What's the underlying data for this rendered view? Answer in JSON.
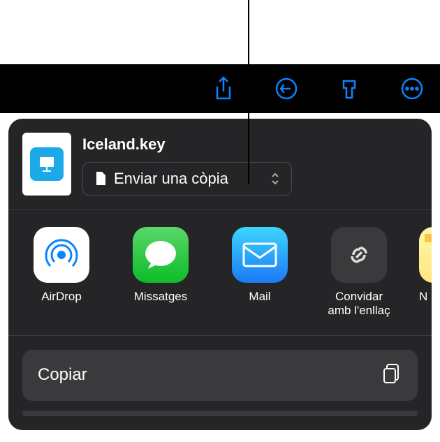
{
  "toolbar": {
    "icons": [
      "share-icon",
      "undo-icon",
      "brush-icon",
      "more-icon"
    ]
  },
  "sheet": {
    "file_name": "Iceland.key",
    "send_copy_label": "Enviar una còpia",
    "apps": [
      {
        "id": "airdrop",
        "label": "AirDrop"
      },
      {
        "id": "messages",
        "label": "Missatges"
      },
      {
        "id": "mail",
        "label": "Mail"
      },
      {
        "id": "invite",
        "label": "Convidar\namb l'enllaç"
      },
      {
        "id": "notes",
        "label": "N"
      }
    ],
    "actions": [
      {
        "id": "copy",
        "label": "Copiar"
      }
    ]
  }
}
